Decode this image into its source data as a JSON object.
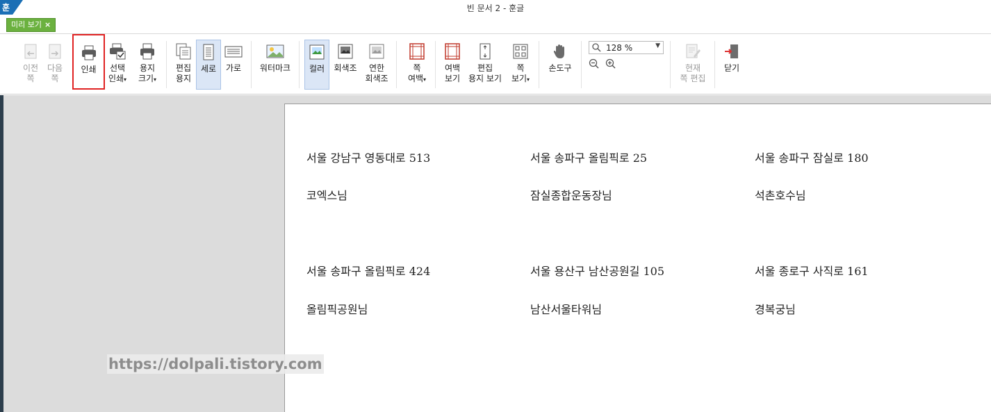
{
  "window": {
    "title": "빈 문서 2 - 훈글",
    "logo": "훈"
  },
  "tabs": {
    "preview_label": "미리 보기",
    "close_glyph": "×"
  },
  "toolbar": {
    "prev_page": [
      "이전",
      "쪽"
    ],
    "next_page": [
      "다음",
      "쪽"
    ],
    "print": [
      "인쇄"
    ],
    "select_print": [
      "선택",
      "인쇄"
    ],
    "paper_size": [
      "용지",
      "크기"
    ],
    "edit_paper": [
      "편집",
      "용지"
    ],
    "portrait": [
      "세로"
    ],
    "landscape": [
      "가로"
    ],
    "watermark": [
      "워터마크"
    ],
    "color": [
      "컬러"
    ],
    "grayscale": [
      "회색조"
    ],
    "light_grayscale": [
      "연한",
      "회색조"
    ],
    "page_margin": [
      "쪽",
      "여백"
    ],
    "margin_view": [
      "여백",
      "보기"
    ],
    "edit_paper_view": [
      "편집",
      "용지 보기"
    ],
    "page_view": [
      "쪽",
      "보기"
    ],
    "hand_tool": [
      "손도구"
    ],
    "current_page_edit": [
      "현재",
      "쪽 편집"
    ],
    "close": [
      "닫기"
    ],
    "zoom_value": "128 %",
    "icons": {
      "prev": "arrow-left-icon",
      "next": "arrow-right-icon",
      "print": "printer-icon",
      "select_print": "printer-check-icon",
      "paper_size": "printer-paper-icon",
      "edit_paper": "pages-icon",
      "portrait": "portrait-page-icon",
      "landscape": "landscape-page-icon",
      "watermark": "watermark-icon",
      "color": "color-image-icon",
      "grayscale": "grayscale-image-icon",
      "light_grayscale": "light-grayscale-image-icon",
      "page_margin": "margin-icon",
      "margin_view": "margin-view-icon",
      "edit_paper_view": "paper-view-icon",
      "page_view": "grid-view-icon",
      "hand": "hand-icon",
      "edit": "edit-page-icon",
      "close": "exit-door-icon"
    }
  },
  "document": {
    "labels": [
      {
        "address": "서울 강남구 영동대로 513",
        "name": "코엑스님"
      },
      {
        "address": "서울 송파구 올림픽로 25",
        "name": "잠실종합운동장님"
      },
      {
        "address": "서울 송파구 잠실로 180",
        "name": "석촌호수님"
      },
      {
        "address": "서울 송파구 올림픽로 424",
        "name": "올림픽공원님"
      },
      {
        "address": "서울 용산구 남산공원길 105",
        "name": "남산서울타워님"
      },
      {
        "address": "서울 종로구 사직로 161",
        "name": "경복궁님"
      }
    ]
  },
  "watermark_text": "https://dolpali.tistory.com",
  "colors": {
    "accent_tab": "#6bb13f",
    "logo": "#1b6fb5",
    "highlight_border": "#e02222",
    "active_bg": "#dbe6f6"
  }
}
